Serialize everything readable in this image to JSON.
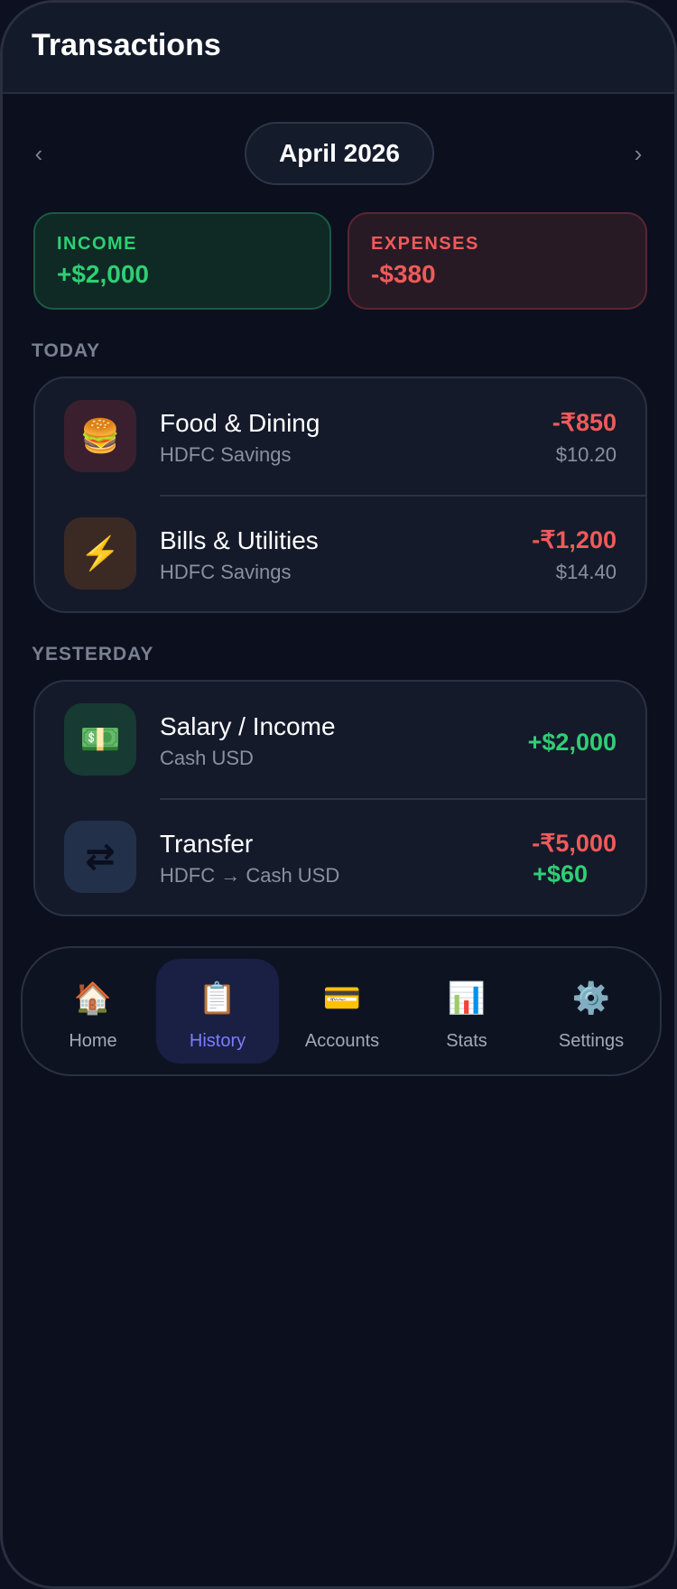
{
  "header": {
    "title": "Transactions"
  },
  "month": {
    "label": "April 2026",
    "prev_icon": "chevron-left-icon",
    "next_icon": "chevron-right-icon"
  },
  "summary": {
    "income": {
      "label": "INCOME",
      "amount": "+$2,000",
      "color": "#2fcf74"
    },
    "expenses": {
      "label": "EXPENSES",
      "amount": "-$380",
      "color": "#f05a5a"
    }
  },
  "groups": [
    {
      "title": "TODAY",
      "items": [
        {
          "icon": "🍔",
          "icon_name": "burger-icon",
          "title": "Food & Dining",
          "account": "HDFC Savings",
          "amount": "-₹850",
          "converted": "$10.20"
        },
        {
          "icon": "⚡",
          "icon_name": "lightning-icon",
          "title": "Bills & Utilities",
          "account": "HDFC Savings",
          "amount": "-₹1,200",
          "converted": "$14.40"
        }
      ]
    },
    {
      "title": "YESTERDAY",
      "items": [
        {
          "icon": "💵",
          "icon_name": "cash-icon",
          "title": "Salary / Income",
          "account": "Cash USD",
          "amount": "+$2,000"
        },
        {
          "icon": "⇄",
          "icon_name": "transfer-icon",
          "title": "Transfer",
          "account": "HDFC → Cash USD",
          "amount": "-₹5,000",
          "amount2": "+$60"
        }
      ]
    }
  ],
  "nav": [
    {
      "icon": "🏠",
      "icon_name": "home-icon",
      "label": "Home"
    },
    {
      "icon": "📋",
      "icon_name": "clipboard-icon",
      "label": "History",
      "active": true
    },
    {
      "icon": "💳",
      "icon_name": "credit-card-icon",
      "label": "Accounts"
    },
    {
      "icon": "📊",
      "icon_name": "bar-chart-icon",
      "label": "Stats"
    },
    {
      "icon": "⚙️",
      "icon_name": "gear-icon",
      "label": "Settings"
    }
  ]
}
